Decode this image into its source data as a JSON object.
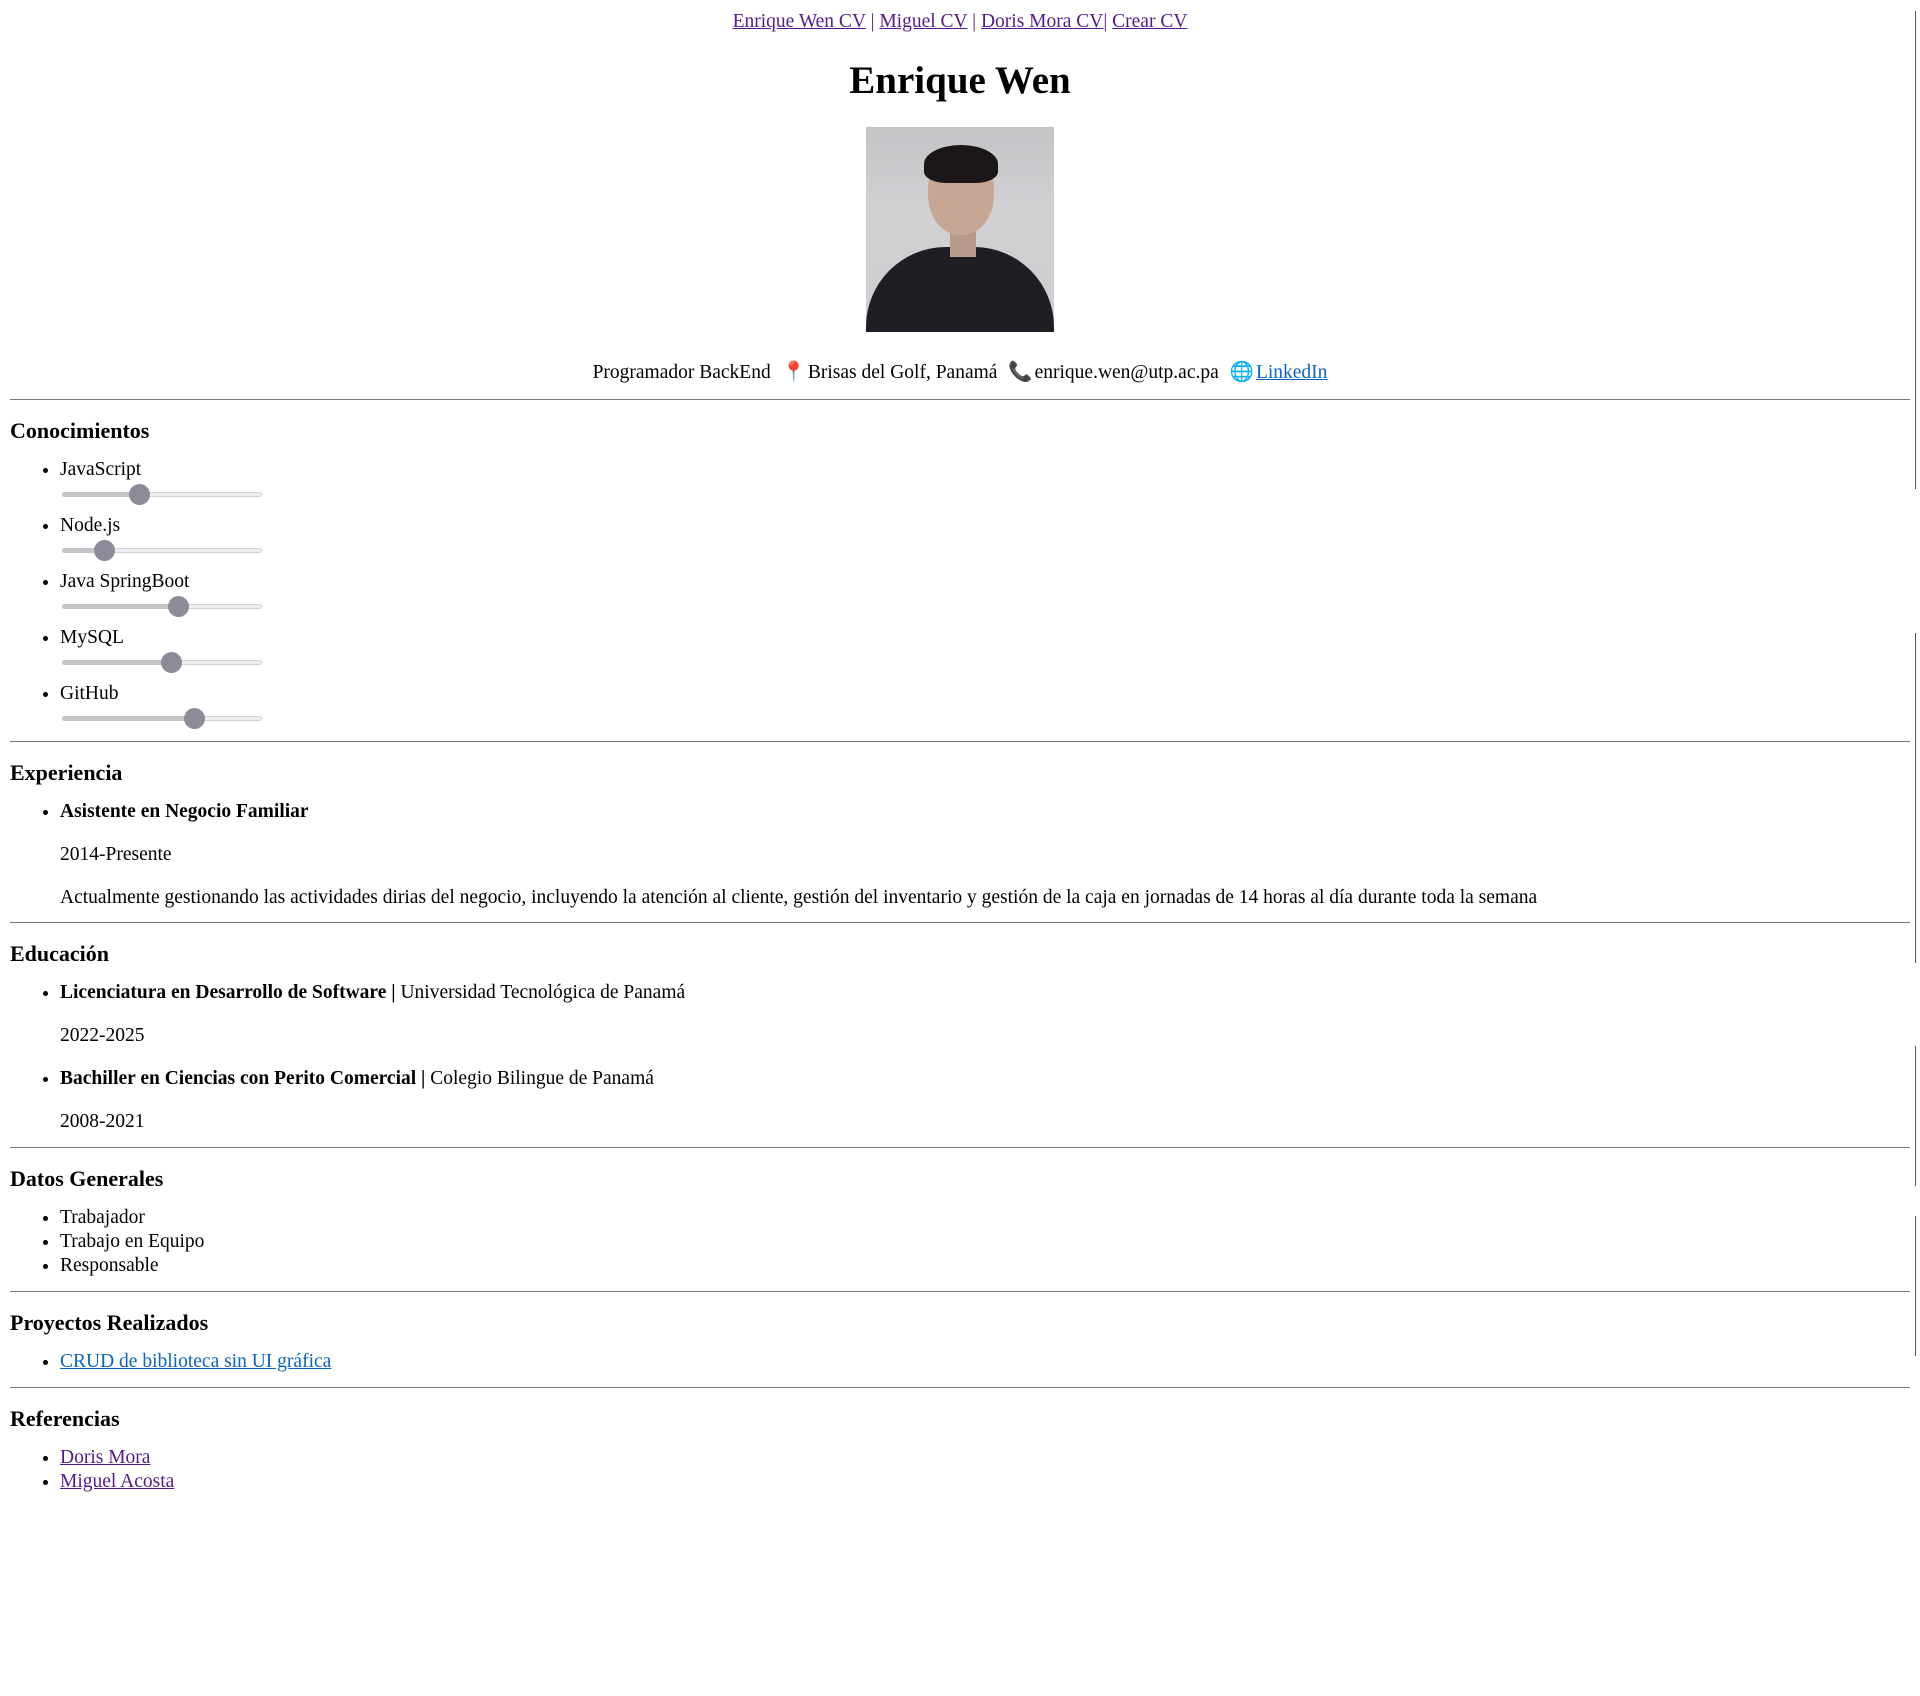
{
  "nav": {
    "links": [
      "Enrique Wen CV",
      "Miguel CV",
      "Doris Mora CV",
      "Crear CV"
    ],
    "separator": " | "
  },
  "name": "Enrique Wen",
  "contact": {
    "role": "Programador BackEnd",
    "location_icon": "pushpin-icon",
    "location": "Brisas del Golf, Panamá",
    "phone_icon": "telephone-icon",
    "email": "enrique.wen@utp.ac.pa",
    "web_icon": "globe-icon",
    "linkedin": "LinkedIn"
  },
  "skills": {
    "title": "Conocimientos",
    "items": [
      {
        "label": "JavaScript",
        "level": 0.37
      },
      {
        "label": "Node.js",
        "level": 0.18
      },
      {
        "label": "Java SpringBoot",
        "level": 0.59
      },
      {
        "label": "MySQL",
        "level": 0.55
      },
      {
        "label": "GitHub",
        "level": 0.68
      }
    ]
  },
  "experience": {
    "title": "Experiencia",
    "items": [
      {
        "role": "Asistente en Negocio Familiar",
        "period": "2014-Presente",
        "description": "Actualmente gestionando las actividades dirias del negocio, incluyendo la atención al cliente, gestión del inventario y gestión de la caja en jornadas de 14 horas al día durante toda la semana"
      }
    ]
  },
  "education": {
    "title": "Educación",
    "items": [
      {
        "degree": "Licenciatura en Desarrollo de Software |",
        "school": "Universidad Tecnológica de Panamá",
        "period": "2022-2025"
      },
      {
        "degree": "Bachiller en Ciencias con Perito Comercial |",
        "school": "Colegio Bilingue de Panamá",
        "period": "2008-2021"
      }
    ]
  },
  "general": {
    "title": "Datos Generales",
    "items": [
      "Trabajador",
      "Trabajo en Equipo",
      "Responsable"
    ]
  },
  "projects": {
    "title": "Proyectos Realizados",
    "items": [
      "CRUD de biblioteca sin UI gráfica"
    ]
  },
  "references": {
    "title": "Referencias",
    "items": [
      "Doris Mora",
      "Miguel Acosta"
    ]
  }
}
